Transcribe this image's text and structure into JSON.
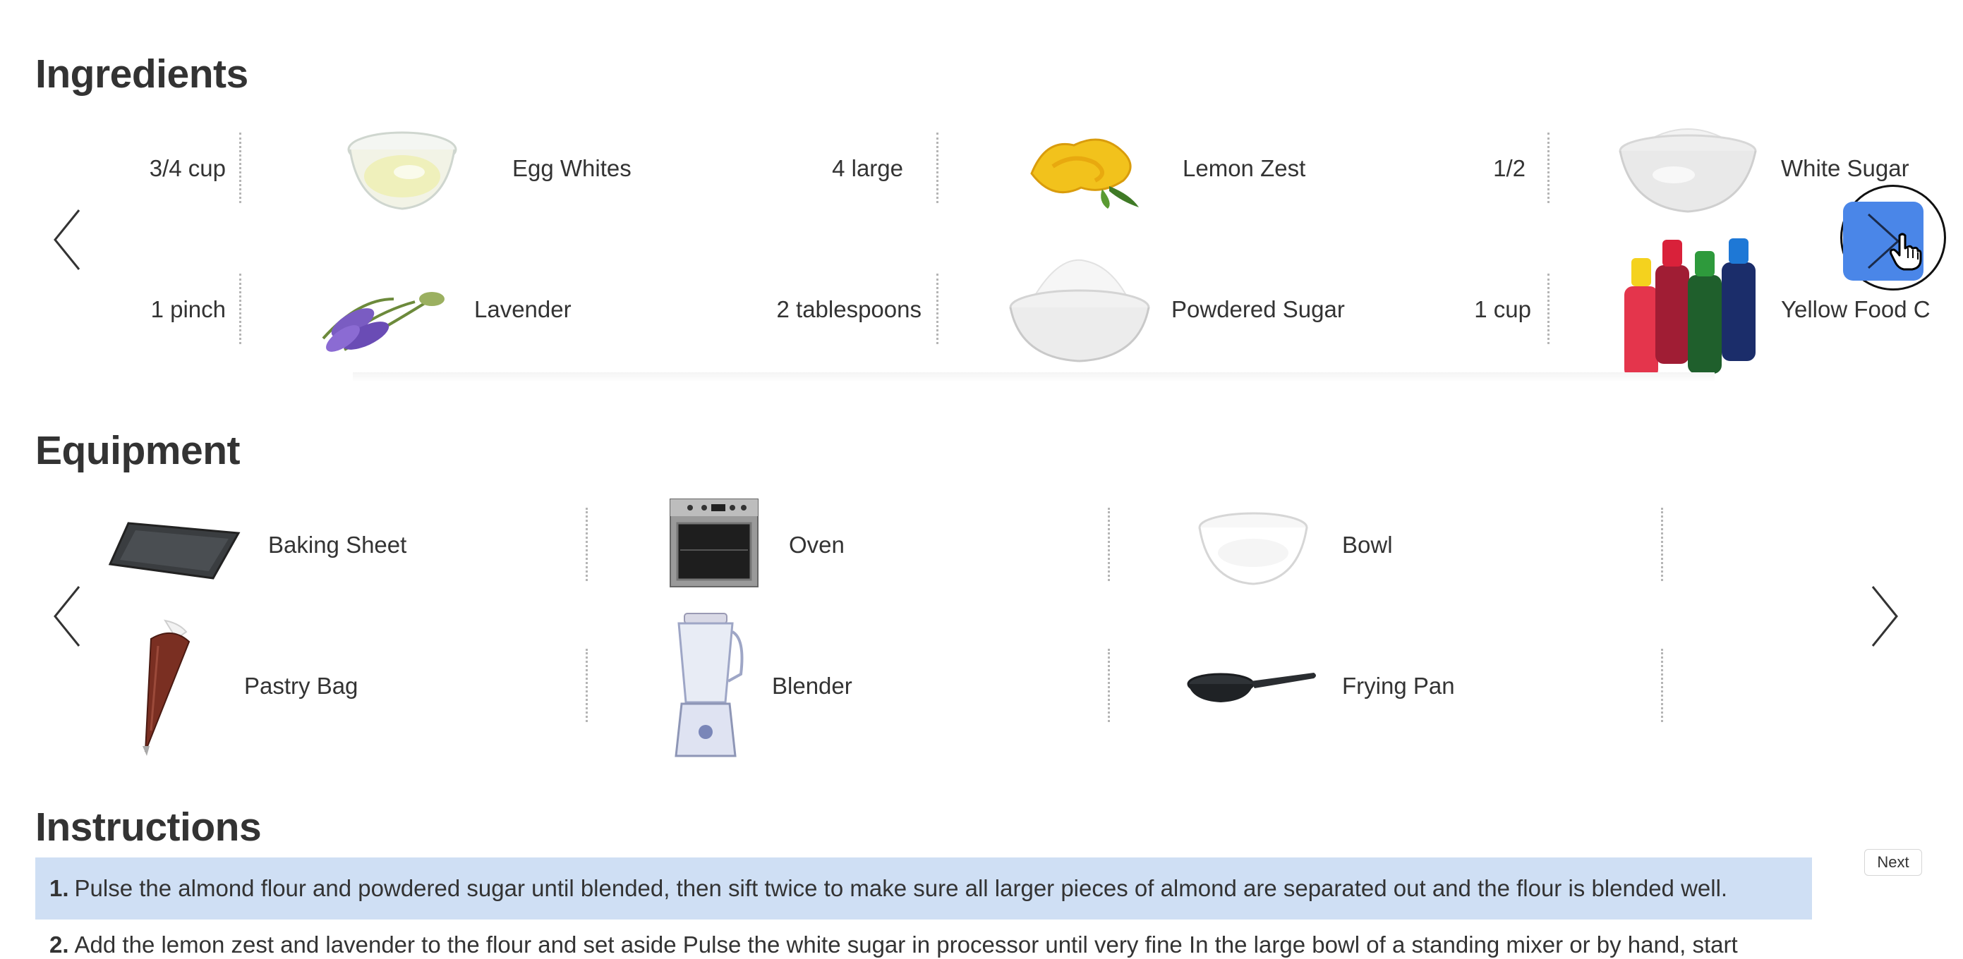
{
  "sections": {
    "ingredients_title": "Ingredients",
    "equipment_title": "Equipment",
    "instructions_title": "Instructions"
  },
  "ingredients": [
    {
      "qty": "3/4 cup",
      "name": "Egg Whites",
      "icon": "egg-whites-icon"
    },
    {
      "qty": "4 large",
      "name": "Lemon Zest",
      "icon": "lemon-zest-icon"
    },
    {
      "qty": "1/2",
      "name": "White Sugar",
      "icon": "white-sugar-icon"
    },
    {
      "qty": "1 pinch",
      "name": "Lavender",
      "icon": "lavender-icon"
    },
    {
      "qty": "2 tablespoons",
      "name": "Powdered Sugar",
      "icon": "powdered-sugar-icon"
    },
    {
      "qty": "1 cup",
      "name": "Yellow Food C",
      "icon": "food-coloring-icon"
    }
  ],
  "equipment": [
    {
      "name": "Baking Sheet",
      "icon": "baking-sheet-icon"
    },
    {
      "name": "Oven",
      "icon": "oven-icon"
    },
    {
      "name": "Bowl",
      "icon": "bowl-icon"
    },
    {
      "name": "Pastry Bag",
      "icon": "pastry-bag-icon"
    },
    {
      "name": "Blender",
      "icon": "blender-icon"
    },
    {
      "name": "Frying Pan",
      "icon": "frying-pan-icon"
    }
  ],
  "instructions": {
    "next_label": "Next",
    "steps": [
      {
        "num": "1.",
        "text": "Pulse the almond flour and powdered sugar until blended, then sift twice to make sure all larger pieces of almond are separated out and the flour is blended well."
      },
      {
        "num": "2.",
        "text": "Add the lemon zest and lavender to the flour and set aside Pulse the white sugar in processor until very fine In the large bowl of a standing mixer or by hand, start"
      }
    ]
  },
  "colors": {
    "active_nav": "#4a86e8",
    "active_step_bg": "#cfdff4",
    "text": "#333333"
  }
}
